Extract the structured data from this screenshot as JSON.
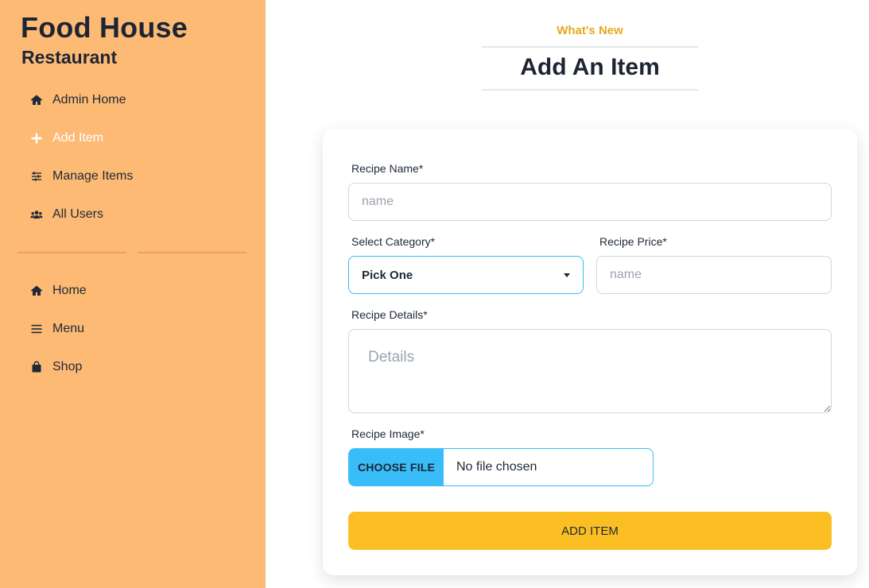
{
  "brand": {
    "title": "Food House",
    "subtitle": "Restaurant"
  },
  "sidebar": {
    "admin_items": [
      {
        "label": "Admin Home",
        "icon": "home-icon",
        "active": false
      },
      {
        "label": "Add Item",
        "icon": "plus-icon",
        "active": true
      },
      {
        "label": "Manage Items",
        "icon": "sliders-icon",
        "active": false
      },
      {
        "label": "All Users",
        "icon": "users-icon",
        "active": false
      }
    ],
    "site_items": [
      {
        "label": "Home",
        "icon": "home-icon"
      },
      {
        "label": "Menu",
        "icon": "menu-icon"
      },
      {
        "label": "Shop",
        "icon": "shopping-bag-icon"
      }
    ]
  },
  "header": {
    "kicker": "What's New",
    "title": "Add An Item"
  },
  "form": {
    "recipe_name": {
      "label": "Recipe Name*",
      "placeholder": "name",
      "value": ""
    },
    "category": {
      "label": "Select Category*",
      "selected": "Pick One"
    },
    "price": {
      "label": "Recipe Price*",
      "placeholder": "name",
      "value": ""
    },
    "details": {
      "label": "Recipe Details*",
      "placeholder": "Details",
      "value": ""
    },
    "image": {
      "label": "Recipe Image*",
      "button": "CHOOSE FILE",
      "status": "No file chosen"
    },
    "submit_label": "ADD ITEM"
  },
  "colors": {
    "sidebar_bg": "#fdba74",
    "accent_yellow": "#fbbf24",
    "accent_blue": "#38bdf8",
    "kicker": "#e7a81c",
    "dark_text": "#1e2433"
  }
}
